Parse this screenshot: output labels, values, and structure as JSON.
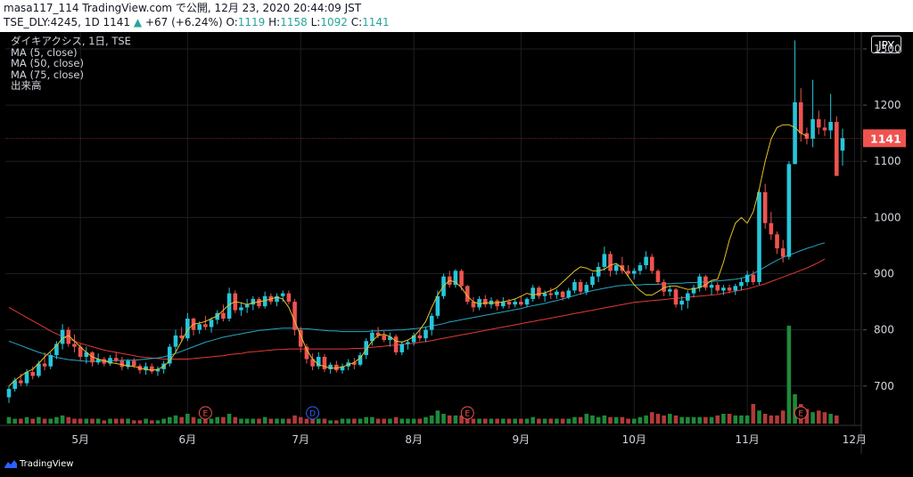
{
  "header": {
    "line1": "masa117_114 TradingView.com で公開, 12月 23, 2020 20:44:09 JST",
    "symbol": "TSE_DLY:4245, 1D",
    "last": "1141",
    "arrow": "▲",
    "change": "+67 (+6.24%)",
    "o_label": "O:",
    "o": "1119",
    "h_label": "H:",
    "h": "1158",
    "l_label": "L:",
    "l": "1092",
    "c_label": "C:",
    "c": "1141"
  },
  "legend": [
    "ダイキアクシス, 1日, TSE",
    "MA (5, close)",
    "MA (50, close)",
    "MA (75, close)",
    "出来高"
  ],
  "currency": "JPY",
  "brand": "TradingView",
  "colors": {
    "up": "#26c6da",
    "down": "#ef5350",
    "ma5": "#e6c229",
    "ma50": "#26a6c6",
    "ma75": "#e53935",
    "vol_up": "#1e8a3a",
    "vol_down": "#b23a38"
  },
  "chart_data": {
    "type": "candlestick",
    "y_ticks": [
      700,
      800,
      900,
      1000,
      1100,
      1200,
      1300
    ],
    "ylim": [
      630,
      1330
    ],
    "last_price_label": "1141",
    "x_month_labels": [
      {
        "label": "5月",
        "index": 12
      },
      {
        "label": "6月",
        "index": 30
      },
      {
        "label": "7月",
        "index": 49
      },
      {
        "label": "8月",
        "index": 68
      },
      {
        "label": "9月",
        "index": 86
      },
      {
        "label": "10月",
        "index": 105
      },
      {
        "label": "11月",
        "index": 124
      },
      {
        "label": "12月",
        "index": 142
      }
    ],
    "events": [
      {
        "label": "E",
        "index": 33,
        "type": "earnings"
      },
      {
        "label": "D",
        "index": 51,
        "type": "dividend"
      },
      {
        "label": "E",
        "index": 77,
        "type": "earnings"
      },
      {
        "label": "E",
        "index": 133,
        "type": "earnings"
      }
    ],
    "candles": [
      [
        680,
        700,
        670,
        695
      ],
      [
        695,
        715,
        690,
        710
      ],
      [
        710,
        722,
        700,
        705
      ],
      [
        705,
        730,
        700,
        725
      ],
      [
        725,
        735,
        712,
        718
      ],
      [
        718,
        745,
        715,
        740
      ],
      [
        740,
        760,
        728,
        735
      ],
      [
        735,
        760,
        730,
        755
      ],
      [
        755,
        780,
        748,
        775
      ],
      [
        775,
        810,
        765,
        800
      ],
      [
        800,
        805,
        770,
        775
      ],
      [
        775,
        792,
        760,
        770
      ],
      [
        770,
        775,
        745,
        752
      ],
      [
        752,
        770,
        740,
        760
      ],
      [
        760,
        762,
        735,
        742
      ],
      [
        742,
        758,
        738,
        748
      ],
      [
        748,
        752,
        735,
        740
      ],
      [
        740,
        755,
        736,
        750
      ],
      [
        750,
        760,
        742,
        745
      ],
      [
        745,
        752,
        728,
        734
      ],
      [
        734,
        748,
        730,
        745
      ],
      [
        745,
        750,
        732,
        736
      ],
      [
        736,
        740,
        722,
        728
      ],
      [
        728,
        742,
        720,
        735
      ],
      [
        735,
        740,
        722,
        726
      ],
      [
        726,
        735,
        718,
        730
      ],
      [
        730,
        745,
        722,
        740
      ],
      [
        740,
        775,
        735,
        770
      ],
      [
        770,
        800,
        760,
        790
      ],
      [
        790,
        805,
        778,
        785
      ],
      [
        785,
        830,
        780,
        820
      ],
      [
        820,
        822,
        790,
        800
      ],
      [
        800,
        815,
        793,
        810
      ],
      [
        810,
        825,
        800,
        805
      ],
      [
        805,
        822,
        795,
        818
      ],
      [
        818,
        835,
        810,
        830
      ],
      [
        830,
        845,
        815,
        820
      ],
      [
        820,
        875,
        815,
        865
      ],
      [
        865,
        870,
        830,
        835
      ],
      [
        835,
        848,
        825,
        840
      ],
      [
        840,
        855,
        830,
        845
      ],
      [
        845,
        860,
        835,
        855
      ],
      [
        855,
        858,
        838,
        842
      ],
      [
        842,
        868,
        838,
        860
      ],
      [
        860,
        865,
        845,
        850
      ],
      [
        850,
        865,
        842,
        860
      ],
      [
        860,
        870,
        850,
        865
      ],
      [
        865,
        870,
        845,
        850
      ],
      [
        850,
        855,
        790,
        800
      ],
      [
        800,
        805,
        760,
        770
      ],
      [
        770,
        775,
        740,
        748
      ],
      [
        748,
        758,
        728,
        735
      ],
      [
        735,
        760,
        730,
        752
      ],
      [
        752,
        757,
        725,
        730
      ],
      [
        730,
        742,
        722,
        738
      ],
      [
        738,
        745,
        724,
        728
      ],
      [
        728,
        740,
        722,
        735
      ],
      [
        735,
        748,
        728,
        742
      ],
      [
        742,
        750,
        730,
        738
      ],
      [
        738,
        760,
        735,
        755
      ],
      [
        755,
        785,
        748,
        780
      ],
      [
        780,
        800,
        772,
        795
      ],
      [
        795,
        805,
        785,
        790
      ],
      [
        790,
        798,
        778,
        782
      ],
      [
        782,
        795,
        770,
        788
      ],
      [
        788,
        792,
        755,
        760
      ],
      [
        760,
        780,
        755,
        775
      ],
      [
        775,
        782,
        765,
        778
      ],
      [
        778,
        795,
        772,
        790
      ],
      [
        790,
        800,
        780,
        785
      ],
      [
        785,
        805,
        778,
        800
      ],
      [
        800,
        830,
        790,
        825
      ],
      [
        825,
        870,
        820,
        860
      ],
      [
        860,
        900,
        855,
        895
      ],
      [
        895,
        905,
        875,
        880
      ],
      [
        880,
        908,
        875,
        905
      ],
      [
        905,
        908,
        870,
        878
      ],
      [
        878,
        880,
        845,
        850
      ],
      [
        850,
        858,
        832,
        840
      ],
      [
        840,
        860,
        835,
        855
      ],
      [
        855,
        862,
        840,
        845
      ],
      [
        845,
        858,
        838,
        852
      ],
      [
        852,
        855,
        835,
        842
      ],
      [
        842,
        858,
        838,
        850
      ],
      [
        850,
        855,
        838,
        845
      ],
      [
        845,
        855,
        840,
        850
      ],
      [
        850,
        860,
        842,
        845
      ],
      [
        845,
        858,
        840,
        855
      ],
      [
        855,
        880,
        850,
        875
      ],
      [
        875,
        878,
        855,
        860
      ],
      [
        860,
        870,
        850,
        865
      ],
      [
        865,
        875,
        855,
        862
      ],
      [
        862,
        872,
        855,
        868
      ],
      [
        868,
        870,
        852,
        858
      ],
      [
        858,
        875,
        855,
        870
      ],
      [
        870,
        890,
        865,
        885
      ],
      [
        885,
        890,
        862,
        868
      ],
      [
        868,
        885,
        862,
        880
      ],
      [
        880,
        902,
        875,
        895
      ],
      [
        895,
        920,
        885,
        912
      ],
      [
        912,
        948,
        905,
        935
      ],
      [
        935,
        940,
        895,
        905
      ],
      [
        905,
        918,
        898,
        915
      ],
      [
        915,
        930,
        900,
        905
      ],
      [
        905,
        915,
        895,
        900
      ],
      [
        900,
        910,
        890,
        905
      ],
      [
        905,
        920,
        898,
        915
      ],
      [
        915,
        940,
        908,
        930
      ],
      [
        930,
        935,
        900,
        905
      ],
      [
        905,
        908,
        880,
        885
      ],
      [
        885,
        890,
        860,
        868
      ],
      [
        868,
        878,
        860,
        872
      ],
      [
        872,
        875,
        840,
        845
      ],
      [
        845,
        860,
        835,
        852
      ],
      [
        852,
        870,
        838,
        865
      ],
      [
        865,
        880,
        858,
        875
      ],
      [
        875,
        900,
        868,
        895
      ],
      [
        895,
        898,
        870,
        875
      ],
      [
        875,
        885,
        862,
        880
      ],
      [
        880,
        885,
        865,
        870
      ],
      [
        870,
        880,
        862,
        875
      ],
      [
        875,
        880,
        865,
        870
      ],
      [
        870,
        882,
        862,
        878
      ],
      [
        878,
        892,
        870,
        885
      ],
      [
        885,
        905,
        878,
        898
      ],
      [
        898,
        905,
        880,
        885
      ],
      [
        885,
        1050,
        880,
        1045
      ],
      [
        1045,
        1060,
        980,
        990
      ],
      [
        990,
        1010,
        960,
        970
      ],
      [
        970,
        975,
        935,
        945
      ],
      [
        945,
        960,
        920,
        930
      ],
      [
        930,
        1100,
        925,
        1095
      ],
      [
        1095,
        1315,
        1140,
        1205
      ],
      [
        1205,
        1230,
        1135,
        1150
      ],
      [
        1150,
        1160,
        1130,
        1140
      ],
      [
        1140,
        1245,
        1125,
        1175
      ],
      [
        1175,
        1190,
        1148,
        1160
      ],
      [
        1160,
        1175,
        1145,
        1155
      ],
      [
        1155,
        1220,
        1140,
        1170
      ],
      [
        1170,
        1180,
        1100,
        1074
      ],
      [
        1119,
        1158,
        1092,
        1141
      ]
    ],
    "ma5": [
      700,
      710,
      718,
      725,
      730,
      740,
      752,
      762,
      772,
      785,
      790,
      780,
      770,
      760,
      752,
      748,
      745,
      742,
      740,
      738,
      736,
      735,
      732,
      730,
      728,
      730,
      735,
      745,
      760,
      780,
      800,
      810,
      812,
      815,
      820,
      825,
      835,
      845,
      850,
      848,
      845,
      848,
      850,
      852,
      855,
      858,
      855,
      840,
      815,
      790,
      765,
      748,
      738,
      735,
      732,
      732,
      734,
      738,
      742,
      750,
      765,
      780,
      790,
      792,
      788,
      780,
      778,
      782,
      788,
      800,
      815,
      840,
      862,
      878,
      888,
      885,
      875,
      860,
      850,
      846,
      848,
      848,
      848,
      850,
      852,
      855,
      860,
      865,
      862,
      864,
      866,
      870,
      875,
      885,
      895,
      905,
      912,
      910,
      905,
      905,
      908,
      915,
      918,
      910,
      895,
      880,
      870,
      862,
      862,
      868,
      875,
      878,
      878,
      875,
      872,
      873,
      875,
      880,
      888,
      890,
      920,
      960,
      990,
      1000,
      990,
      1010,
      1050,
      1100,
      1140,
      1160,
      1165,
      1165,
      1160,
      1150,
      1145
    ],
    "ma50": [
      780,
      776,
      772,
      768,
      764,
      760,
      757,
      754,
      751,
      749,
      747,
      746,
      745,
      744,
      744,
      744,
      744,
      745,
      745,
      746,
      746,
      746,
      747,
      748,
      749,
      750,
      752,
      755,
      758,
      762,
      766,
      770,
      774,
      778,
      781,
      784,
      787,
      789,
      791,
      793,
      795,
      797,
      799,
      800,
      801,
      802,
      803,
      803,
      803,
      802,
      802,
      801,
      800,
      799,
      798,
      798,
      797,
      797,
      797,
      797,
      797,
      798,
      798,
      799,
      799,
      800,
      800,
      801,
      802,
      803,
      805,
      807,
      809,
      811,
      814,
      816,
      818,
      820,
      822,
      824,
      826,
      828,
      830,
      832,
      834,
      836,
      838,
      841,
      843,
      845,
      847,
      850,
      852,
      855,
      858,
      861,
      864,
      867,
      870,
      872,
      874,
      876,
      878,
      879,
      880,
      880,
      880,
      881,
      881,
      881,
      882,
      882,
      883,
      883,
      884,
      884,
      885,
      885,
      886,
      887,
      888,
      889,
      890,
      892,
      895,
      900,
      906,
      912,
      918,
      924,
      929,
      933,
      937,
      941,
      945,
      948,
      952,
      955
    ],
    "ma75": [
      840,
      834,
      828,
      822,
      816,
      810,
      804,
      798,
      793,
      788,
      784,
      780,
      776,
      773,
      770,
      767,
      764,
      762,
      760,
      758,
      756,
      754,
      752,
      751,
      750,
      749,
      748,
      748,
      748,
      748,
      748,
      749,
      750,
      751,
      752,
      753,
      754,
      756,
      757,
      758,
      760,
      761,
      762,
      763,
      764,
      765,
      765,
      766,
      766,
      766,
      766,
      766,
      766,
      766,
      766,
      766,
      766,
      766,
      767,
      767,
      768,
      769,
      770,
      771,
      772,
      773,
      774,
      775,
      776,
      778,
      779,
      781,
      783,
      785,
      787,
      789,
      791,
      793,
      795,
      797,
      799,
      801,
      803,
      805,
      807,
      809,
      811,
      813,
      815,
      817,
      819,
      821,
      823,
      825,
      827,
      829,
      831,
      833,
      835,
      837,
      839,
      841,
      843,
      845,
      847,
      849,
      850,
      851,
      852,
      853,
      854,
      855,
      856,
      857,
      858,
      859,
      860,
      861,
      862,
      863,
      865,
      867,
      869,
      871,
      873,
      876,
      879,
      882,
      886,
      890,
      894,
      898,
      902,
      906,
      910,
      915,
      920,
      926
    ],
    "volume": [
      4,
      3,
      3,
      4,
      3,
      4,
      3,
      3,
      4,
      5,
      4,
      3,
      3,
      3,
      3,
      3,
      2,
      3,
      3,
      3,
      3,
      2,
      2,
      3,
      2,
      2,
      3,
      4,
      5,
      4,
      6,
      4,
      3,
      4,
      3,
      4,
      4,
      6,
      4,
      3,
      3,
      3,
      3,
      4,
      3,
      3,
      3,
      3,
      5,
      4,
      3,
      3,
      3,
      3,
      2,
      2,
      3,
      3,
      3,
      3,
      4,
      4,
      3,
      3,
      3,
      4,
      3,
      3,
      3,
      3,
      4,
      5,
      8,
      6,
      5,
      5,
      5,
      4,
      3,
      3,
      3,
      3,
      3,
      3,
      3,
      3,
      3,
      3,
      4,
      3,
      3,
      3,
      3,
      3,
      3,
      4,
      4,
      6,
      5,
      4,
      5,
      4,
      4,
      4,
      3,
      3,
      4,
      5,
      7,
      6,
      5,
      6,
      5,
      4,
      4,
      4,
      4,
      4,
      4,
      5,
      6,
      6,
      5,
      5,
      5,
      12,
      8,
      6,
      5,
      5,
      8,
      60,
      18,
      12,
      9,
      7,
      8,
      7,
      6,
      5
    ]
  }
}
